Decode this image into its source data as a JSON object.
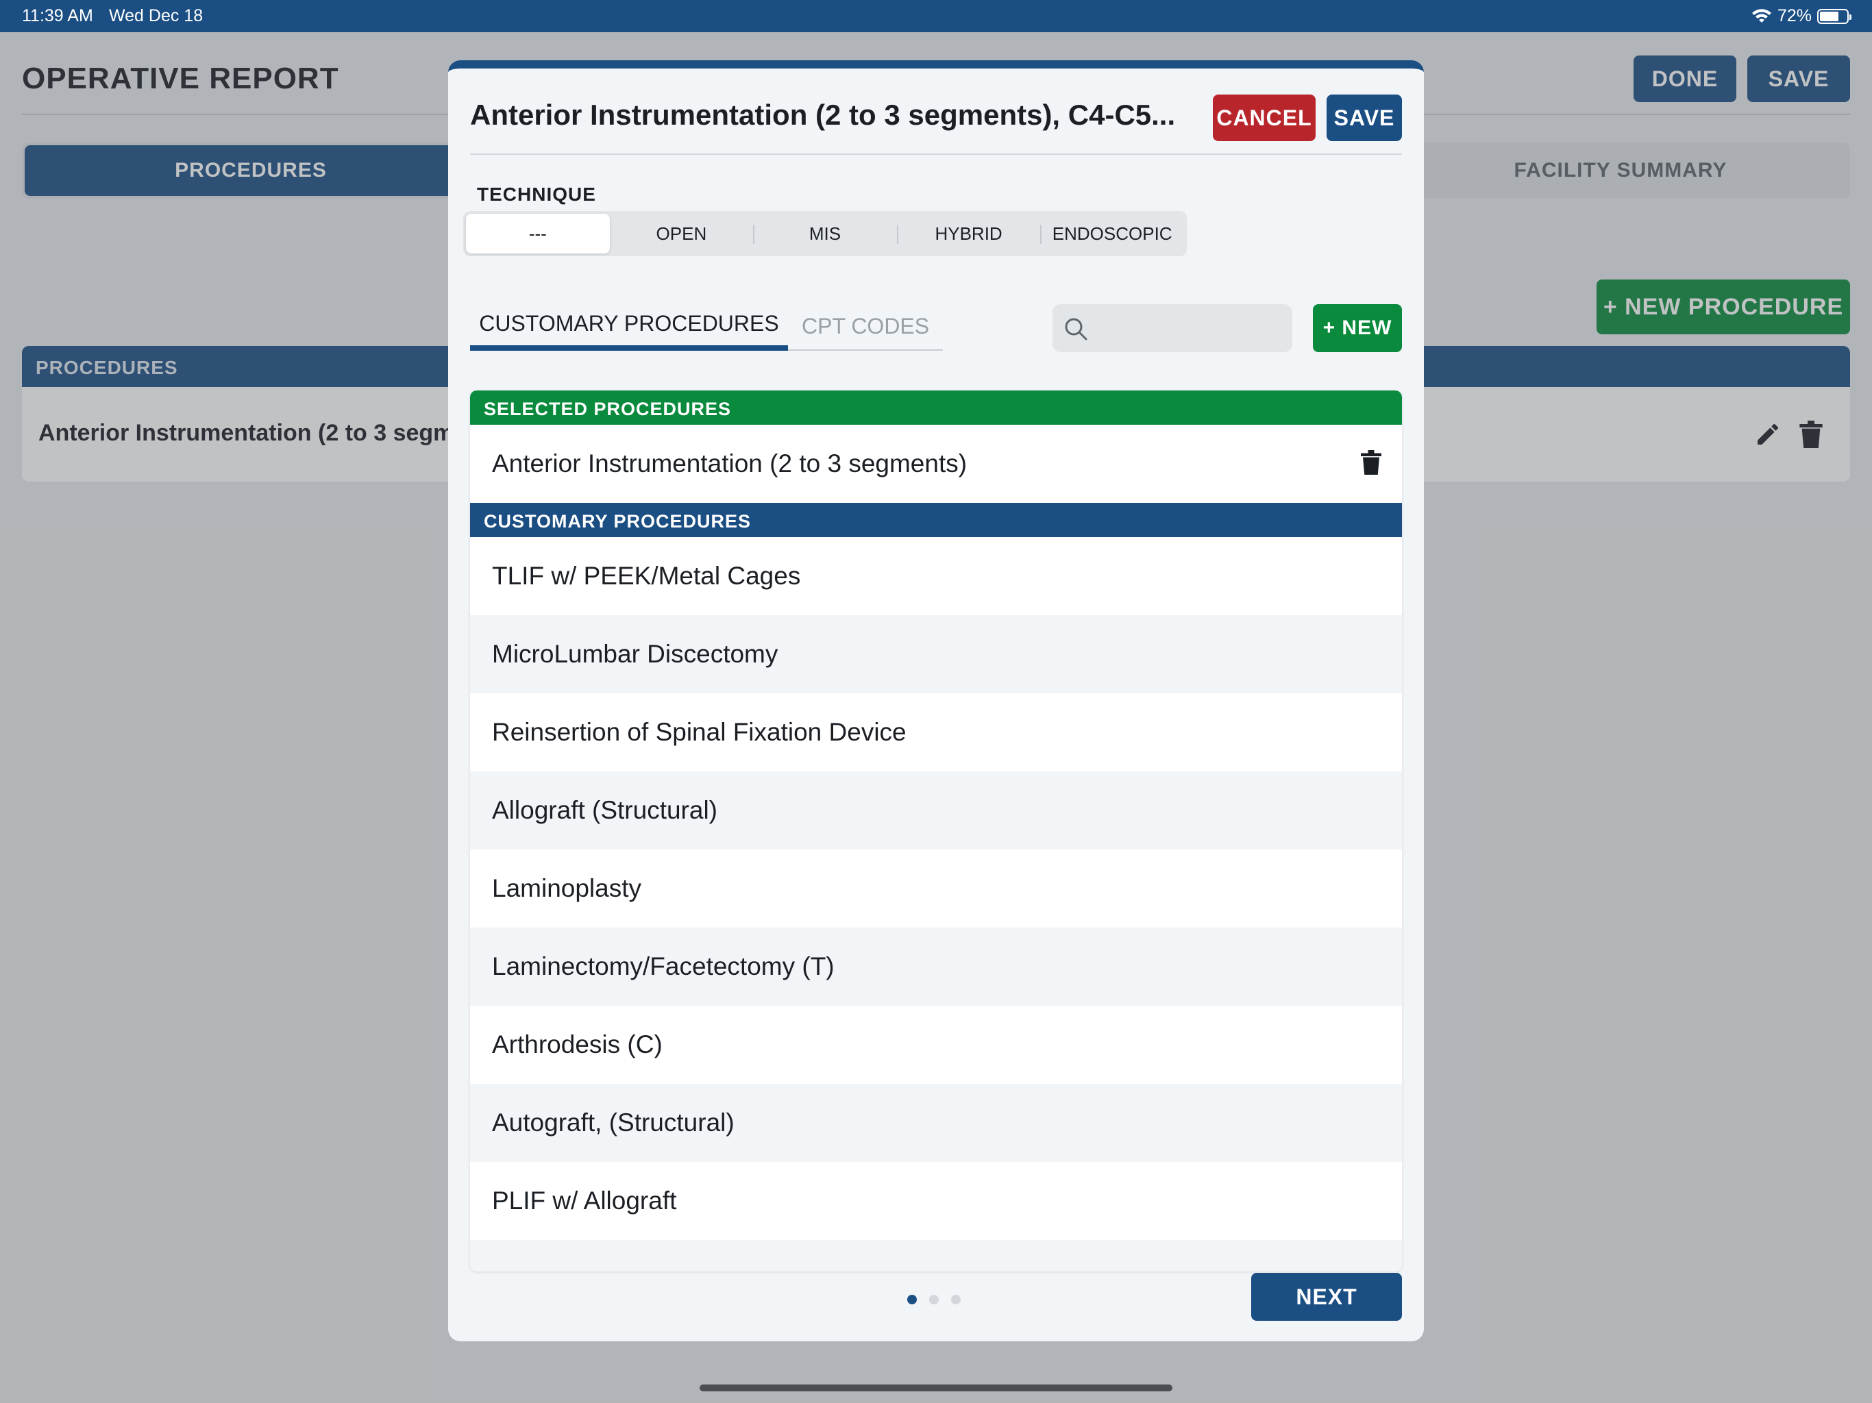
{
  "status_bar": {
    "time": "11:39 AM",
    "date": "Wed Dec 18",
    "battery": "72%",
    "battery_level": 0.72
  },
  "page": {
    "title": "OPERATIVE REPORT",
    "done_label": "DONE",
    "save_label": "SAVE",
    "tabs": {
      "procedures": "PROCEDURES",
      "facility_summary": "FACILITY SUMMARY"
    },
    "new_procedure_label": "+ NEW PROCEDURE",
    "panel_header": "PROCEDURES",
    "panel_row": "Anterior Instrumentation (2 to 3 segments), C4-C5"
  },
  "modal": {
    "title": "Anterior Instrumentation (2 to 3 segments), C4-C5...",
    "cancel_label": "CANCEL",
    "save_label": "SAVE",
    "technique_label": "TECHNIQUE",
    "technique_options": [
      "---",
      "OPEN",
      "MIS",
      "HYBRID",
      "ENDOSCOPIC"
    ],
    "technique_selected": "---",
    "tabs": {
      "customary": "CUSTOMARY PROCEDURES",
      "cpt": "CPT CODES"
    },
    "search_placeholder": "",
    "new_label": "+ NEW",
    "selected_header": "SELECTED PROCEDURES",
    "selected_items": [
      "Anterior Instrumentation (2 to 3 segments)"
    ],
    "customary_header": "CUSTOMARY PROCEDURES",
    "customary_items": [
      "TLIF w/ PEEK/Metal Cages",
      "MicroLumbar Discectomy",
      "Reinsertion of Spinal Fixation Device",
      "Allograft (Structural)",
      "Laminoplasty",
      "Laminectomy/Facetectomy (T)",
      "Arthrodesis  (C)",
      "Autograft, (Structural)",
      "PLIF w/ Allograft"
    ],
    "next_label": "NEXT",
    "page_count": 3,
    "current_page": 1
  },
  "colors": {
    "primary": "#1b4e83",
    "success": "#0a8a3c",
    "danger": "#b8252b"
  }
}
